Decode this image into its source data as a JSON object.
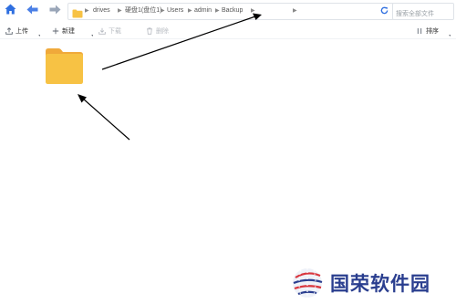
{
  "address_bar": {
    "breadcrumbs": [
      {
        "label": "drives"
      },
      {
        "label": "硬盘1(盘位1)"
      },
      {
        "label": "Users"
      },
      {
        "label": "admin"
      },
      {
        "label": "Backup"
      }
    ],
    "search_placeholder": "搜索全部文件"
  },
  "toolbar": {
    "upload_label": "上传",
    "new_label": "新建",
    "download_label": "下载",
    "delete_label": "删除",
    "sort_label": "排序"
  },
  "watermark": {
    "text": "国荣软件园"
  },
  "colors": {
    "nav_blue": "#2f6fe0",
    "folder_yellow": "#f7c244",
    "folder_tab": "#f0a93a",
    "logo_blue": "#2a3e8f",
    "logo_red": "#d9363e"
  }
}
